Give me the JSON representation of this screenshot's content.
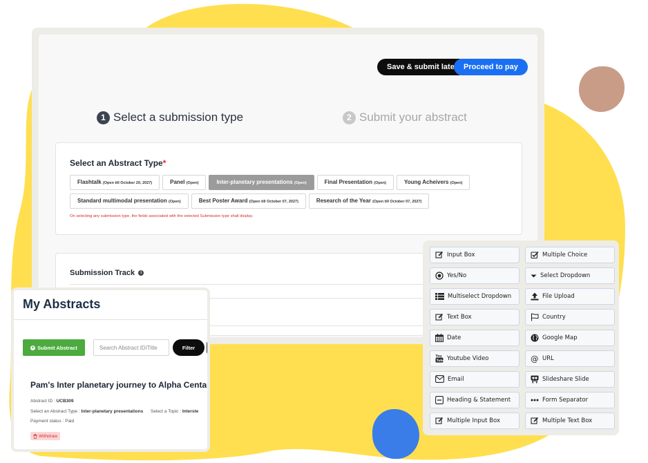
{
  "colors": {
    "yellow_blob": "#ffdf4f",
    "brown_blob": "#c89c87",
    "blue_blob": "#3a7de8",
    "primary": "#1a6ff2",
    "green": "#4caa3e",
    "danger": "#d42a2a"
  },
  "header": {
    "save_label": "Save & submit later",
    "pay_label": "Proceed to pay"
  },
  "steps": [
    {
      "number": "1",
      "label": "Select a submission type"
    },
    {
      "number": "2",
      "label": "Submit your abstract"
    }
  ],
  "abstract_type": {
    "title": "Select an Abstract Type",
    "required_mark": "*",
    "chips": [
      {
        "label": "Flashtalk",
        "status": "(Open till October 20, 2027)"
      },
      {
        "label": "Panel",
        "status": "(Open)"
      },
      {
        "label": "Inter-planetary presentations",
        "status": "(Open)"
      },
      {
        "label": "Final Presentation",
        "status": "(Open)"
      },
      {
        "label": "Young Acheivers",
        "status": "(Open)"
      },
      {
        "label": "Standard multimodal presentation",
        "status": "(Open)"
      },
      {
        "label": "Best Poster Award",
        "status": "(Open till October 07, 2027)"
      },
      {
        "label": "Research of the Year",
        "status": "(Open till October 07, 2027)"
      }
    ],
    "note": "On selecting any submission type, the fields associated with the selected Submission type shall display."
  },
  "submission_track": {
    "title": "Submission Track",
    "info_icon": "i"
  },
  "my_abstracts": {
    "title": "My Abstracts",
    "submit_label": "Submit Abstract",
    "plus_icon": "+",
    "search_placeholder": "Search Abstract ID/Title",
    "filter_label": "Filter",
    "item": {
      "title": "Pam's Inter planetary journey to Alpha Centauri",
      "id_label": "Abstract ID :",
      "id_value": "UCB309",
      "type_label": "Select an Abstract Type :",
      "type_value": "Inter-planetary presentations",
      "topic_label": "Select a Topic :",
      "topic_value": "Interste",
      "payment_label": "Payment status :",
      "payment_value": "Paid",
      "withdraw_label": "Withdraw"
    }
  },
  "field_palette": [
    {
      "label": "Input Box",
      "icon": "edit-icon"
    },
    {
      "label": "Multiple Choice",
      "icon": "checkbox-icon"
    },
    {
      "label": "Yes/No",
      "icon": "radio-icon"
    },
    {
      "label": "Select Dropdown",
      "icon": "caret-down-icon"
    },
    {
      "label": "Multiselect Dropdown",
      "icon": "list-icon"
    },
    {
      "label": "File Upload",
      "icon": "upload-icon"
    },
    {
      "label": "Text Box",
      "icon": "edit-icon"
    },
    {
      "label": "Country",
      "icon": "flag-icon"
    },
    {
      "label": "Date",
      "icon": "calendar-icon"
    },
    {
      "label": "Google Map",
      "icon": "globe-icon"
    },
    {
      "label": "Youtube Video",
      "icon": "youtube-icon"
    },
    {
      "label": "URL",
      "icon": "at-icon"
    },
    {
      "label": "Email",
      "icon": "envelope-icon"
    },
    {
      "label": "Slideshare Slide",
      "icon": "slideshare-icon"
    },
    {
      "label": "Heading & Statement",
      "icon": "heading-icon"
    },
    {
      "label": "Form Separator",
      "icon": "dots-icon"
    },
    {
      "label": "Multiple Input Box",
      "icon": "edit-icon"
    },
    {
      "label": "Multiple Text Box",
      "icon": "edit-icon"
    }
  ]
}
